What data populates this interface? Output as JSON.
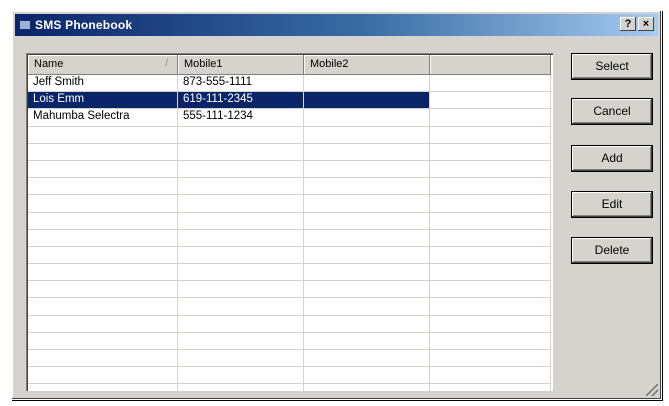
{
  "window": {
    "title": "SMS Phonebook",
    "help_label": "?",
    "close_label": "×"
  },
  "list": {
    "columns": [
      "Name",
      "Mobile1",
      "Mobile2",
      ""
    ],
    "sort_indicator": "/",
    "rows": [
      {
        "name": "Jeff Smith",
        "mobile1": "873-555-1111",
        "mobile2": "",
        "selected": false
      },
      {
        "name": "Lois Emm",
        "mobile1": "619-111-2345",
        "mobile2": "",
        "selected": true
      },
      {
        "name": "Mahumba Selectra",
        "mobile1": "555-111-1234",
        "mobile2": "",
        "selected": false
      }
    ],
    "empty_row_count": 16
  },
  "buttons": {
    "select": "Select",
    "cancel": "Cancel",
    "add": "Add",
    "edit": "Edit",
    "delete": "Delete"
  },
  "colors": {
    "title_start": "#0a246a",
    "title_end": "#a6caf0",
    "face": "#d6d3ce",
    "selection": "#0a246a"
  }
}
